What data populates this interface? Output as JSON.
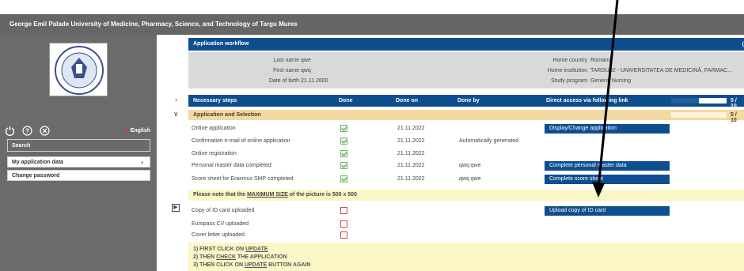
{
  "university_title": "George Emil Palade University of Medicine, Pharmacy, Science, and Technology of Targu Mures",
  "sidebar": {
    "language": "English",
    "search_label": "Search",
    "items": [
      {
        "label": "My application data"
      },
      {
        "label": "Change password"
      }
    ]
  },
  "workflow": {
    "title": "Application workflow",
    "badge": "("
  },
  "personal": {
    "last_name_label": "Last name",
    "last_name": "qwe",
    "first_name_label": "First name",
    "first_name": "qwq",
    "dob_label": "Date of birth",
    "dob": "21.11.2000",
    "home_country_label": "Home country",
    "home_country": "Romania",
    "home_institution_label": "Home institution",
    "home_institution": "TARGU02 - UNIVERSITATEA DE MEDICINĂ, FARMAC...",
    "study_program_label": "Study program",
    "study_program": "General Nursing"
  },
  "steps_header": {
    "col1": "Necessary steps",
    "col2": "Done",
    "col3": "Done on",
    "col4": "Done by",
    "col5": "Direct access via following link",
    "progress_text": "5 / 10",
    "progress_fraction": 0.5
  },
  "section": {
    "title": "Application and Selection",
    "progress_text": "5 / 10"
  },
  "rows": [
    {
      "label": "Online application",
      "done": true,
      "date": "21.11.2022",
      "by": "",
      "action": "Display/Change application"
    },
    {
      "label": "Confirmation e-mail of online application",
      "done": true,
      "date": "21.11.2022",
      "by": "Automatically generated",
      "action": ""
    },
    {
      "label": "Online registration",
      "done": true,
      "date": "21.11.2022",
      "by": "",
      "action": ""
    },
    {
      "label": "Personal master data completed",
      "done": true,
      "date": "21.11.2022",
      "by": "qwq qwe",
      "action": "Complete personal master data"
    },
    {
      "label": "Score sheet for Erasmus SMP completed",
      "done": true,
      "date": "21.11.2022",
      "by": "qwq qwe",
      "action": "Complete score sheet"
    }
  ],
  "note": {
    "pre": "Please note that the ",
    "emph": "MAXIMUM SIZE",
    "post": " of the picture is 500 x 500"
  },
  "uploads": [
    {
      "label": "Copy of ID card uploaded",
      "done": false,
      "action": "Upload copy of ID card"
    },
    {
      "label": "Europass CV uploaded",
      "done": false,
      "action": ""
    },
    {
      "label": "Cover letter uploaded",
      "done": false,
      "action": ""
    }
  ],
  "instructions": {
    "l1_pre": "1) FIRST CLICK ON ",
    "l1_link": "UPDATE",
    "l2_pre": "2) THEN ",
    "l2_link": "CHECK",
    "l2_post": " THE APPLICATION",
    "l3_pre": "3) THEN CLICK ON ",
    "l3_link": "UPDATE",
    "l3_post": " BUTTON AGAIN"
  },
  "colors": {
    "primary": "#0e4e8f",
    "sidebar": "#6b6b6b",
    "section": "#f3d9a4",
    "note": "#fbf6c6"
  }
}
